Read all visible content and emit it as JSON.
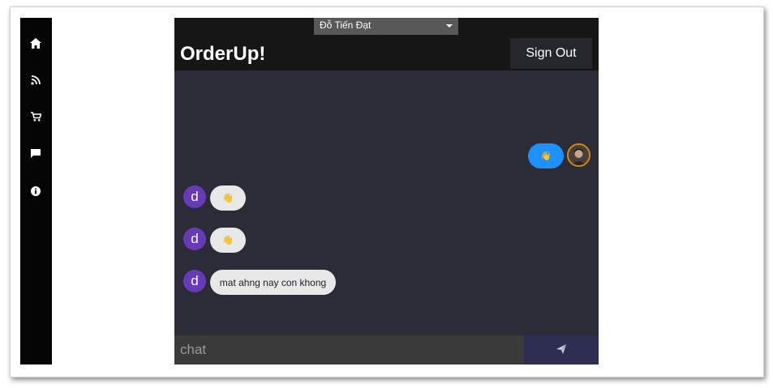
{
  "sidebar": {
    "items": [
      {
        "icon": "home-icon"
      },
      {
        "icon": "rss-feed-icon"
      },
      {
        "icon": "cart-icon"
      },
      {
        "icon": "chat-icon"
      },
      {
        "icon": "info-icon"
      }
    ]
  },
  "header": {
    "user_select_value": "Đỗ Tiến Đạt",
    "brand": "OrderUp!",
    "signout_label": "Sign Out"
  },
  "messages": [
    {
      "from": "self",
      "icon": "waving-hand-icon"
    },
    {
      "from": "d",
      "avatar_letter": "d",
      "icon": "waving-hand-icon"
    },
    {
      "from": "d",
      "avatar_letter": "d",
      "icon": "waving-hand-icon"
    },
    {
      "from": "d",
      "avatar_letter": "d",
      "text": "mat ahng nay con khong"
    }
  ],
  "composer": {
    "placeholder": "chat",
    "send_icon": "send-icon"
  },
  "colors": {
    "app_bg": "#2c2b38",
    "topbar_bg": "#161616",
    "own_bubble": "#1e90ff",
    "other_bubble": "#e8e8e8",
    "avatar_bg": "#673ab7",
    "send_bg": "#2e2d52"
  }
}
